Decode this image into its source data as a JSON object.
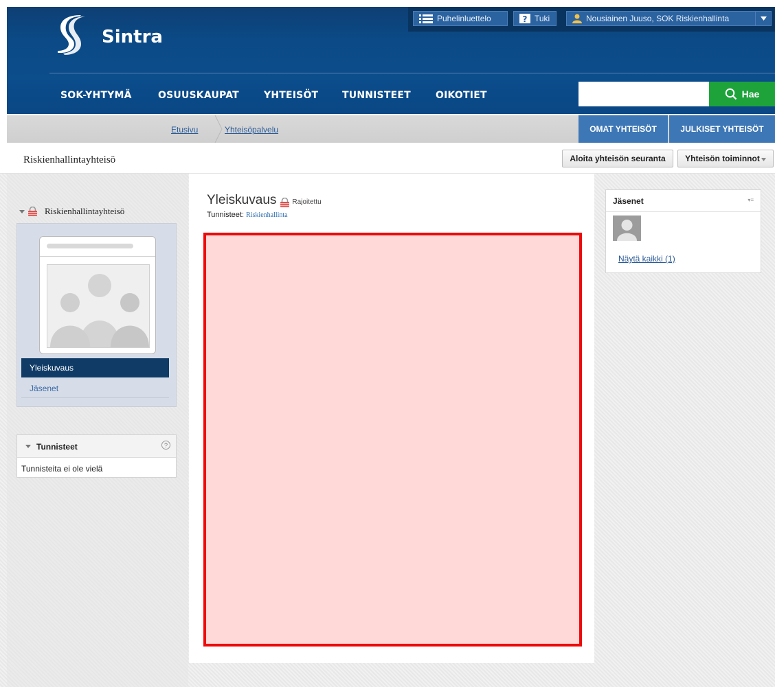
{
  "brand": {
    "name": "Sintra"
  },
  "topbar": {
    "phonebook_label": "Puhelinluettelo",
    "support_label": "Tuki",
    "user_label": "Nousiainen Juuso, SOK Riskienhallinta"
  },
  "nav": {
    "items": [
      {
        "label": "SOK-YHTYMÄ"
      },
      {
        "label": "OSUUSKAUPAT"
      },
      {
        "label": "YHTEISÖT"
      },
      {
        "label": "TUNNISTEET"
      },
      {
        "label": "OIKOTIET"
      }
    ],
    "search": {
      "value": "",
      "button_label": "Hae"
    }
  },
  "breadcrumb": {
    "items": [
      {
        "label": "Etusivu"
      },
      {
        "label": "Yhteisöpalvelu"
      }
    ]
  },
  "tabs": {
    "own_label": "OMAT YHTEISÖT",
    "public_label": "JULKISET YHTEISÖT"
  },
  "title_row": {
    "title": "Riskienhallintayhteisö",
    "follow_label": "Aloita yhteisön seuranta",
    "actions_label": "Yhteisön toiminnot"
  },
  "sidebar": {
    "community_name": "Riskienhallintayhteisö",
    "menu": [
      {
        "label": "Yleiskuvaus",
        "active": true
      },
      {
        "label": "Jäsenet",
        "active": false
      }
    ],
    "tags_widget": {
      "title": "Tunnisteet",
      "empty_text": "Tunnisteita ei ole vielä"
    }
  },
  "main": {
    "title": "Yleiskuvaus",
    "access_badge": "Rajoitettu",
    "tags_label": "Tunnisteet:",
    "tag_link": "Riskienhallinta"
  },
  "members_widget": {
    "title": "Jäsenet",
    "show_all_label": "Näytä kaikki (1)"
  },
  "colors": {
    "header_blue": "#0b4a86",
    "search_green": "#1ea33b",
    "tab_blue": "#3d77b6",
    "sidebar_active": "#0f3b66",
    "highlight_red": "#ee0a0a"
  },
  "icons": [
    "list-icon",
    "help-icon",
    "user-icon",
    "chevron-down-icon",
    "search-icon",
    "lock-icon",
    "menu-icon",
    "avatar"
  ]
}
